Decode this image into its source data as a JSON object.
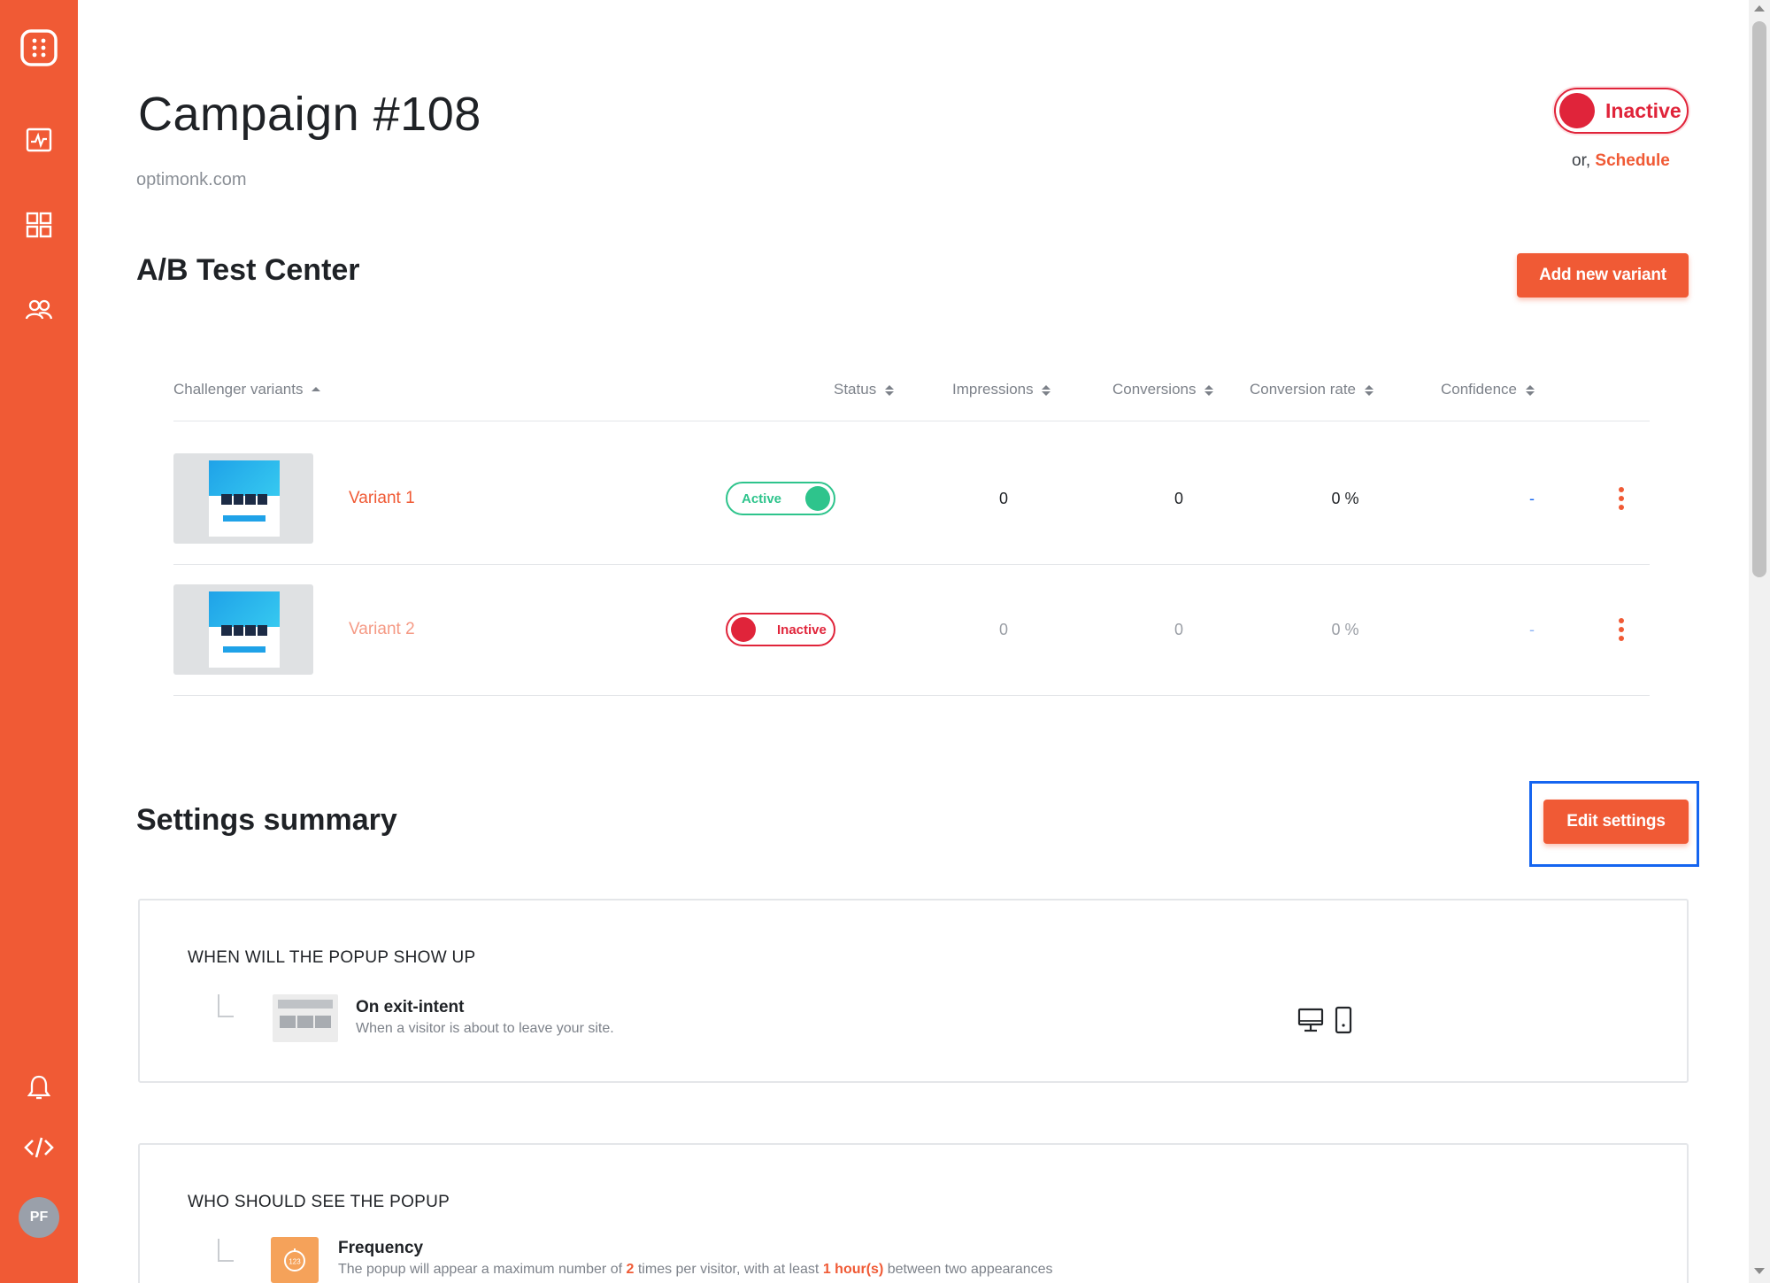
{
  "sidebar": {
    "icons": [
      "logo-icon",
      "analytics-icon",
      "dashboard-grid-icon",
      "users-icon",
      "bell-icon",
      "code-icon"
    ],
    "avatar": "PF"
  },
  "header": {
    "title": "Campaign #108",
    "domain": "optimonk.com",
    "status_label": "Inactive",
    "schedule_prefix": "or,",
    "schedule_link": "Schedule"
  },
  "ab_test": {
    "title": "A/B Test Center",
    "add_button": "Add new variant",
    "columns": [
      "Challenger variants",
      "Status",
      "Impressions",
      "Conversions",
      "Conversion rate",
      "Confidence"
    ],
    "rows": [
      {
        "name": "Variant 1",
        "status": "Active",
        "impressions": "0",
        "conversions": "0",
        "conversion_rate": "0 %",
        "confidence": "-"
      },
      {
        "name": "Variant 2",
        "status": "Inactive",
        "impressions": "0",
        "conversions": "0",
        "conversion_rate": "0 %",
        "confidence": "-"
      }
    ]
  },
  "settings": {
    "title": "Settings summary",
    "edit_button": "Edit settings",
    "when": {
      "title": "WHEN WILL THE POPUP SHOW UP",
      "rule_name": "On exit-intent",
      "rule_desc": "When a visitor is about to leave your site."
    },
    "who": {
      "title": "WHO SHOULD SEE THE POPUP",
      "rule_name": "Frequency",
      "desc_1": "The popup will appear a maximum number of",
      "count": "2",
      "desc_2": "times per visitor, with at least",
      "interval": "1 hour(s)",
      "desc_3": "between two appearances",
      "icon_text": "123"
    }
  },
  "colors": {
    "brand": "#f05a35",
    "active": "#2ec48c",
    "inactive": "#e0243a",
    "focus": "#1565f0"
  }
}
